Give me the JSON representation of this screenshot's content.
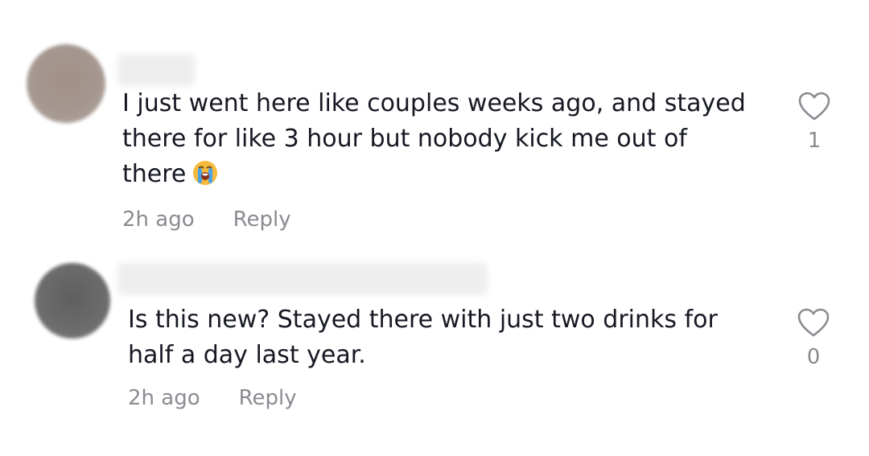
{
  "comments": [
    {
      "text": "I just went here like couples weeks ago, and stayed\nthere for like 3 hour but nobody kick me out of\nthere",
      "emoji": "loudly-crying-face",
      "time": "2h ago",
      "reply_label": "Reply",
      "likes": "1",
      "avatar_color": "#a59790"
    },
    {
      "text": "Is this new? Stayed there with just two drinks for\nhalf a day last year.",
      "time": "2h ago",
      "reply_label": "Reply",
      "likes": "0",
      "avatar_color": "#6b6b6b"
    }
  ],
  "colors": {
    "text": "#161823",
    "meta": "#8a8b91",
    "name_blur": "#ececec"
  }
}
